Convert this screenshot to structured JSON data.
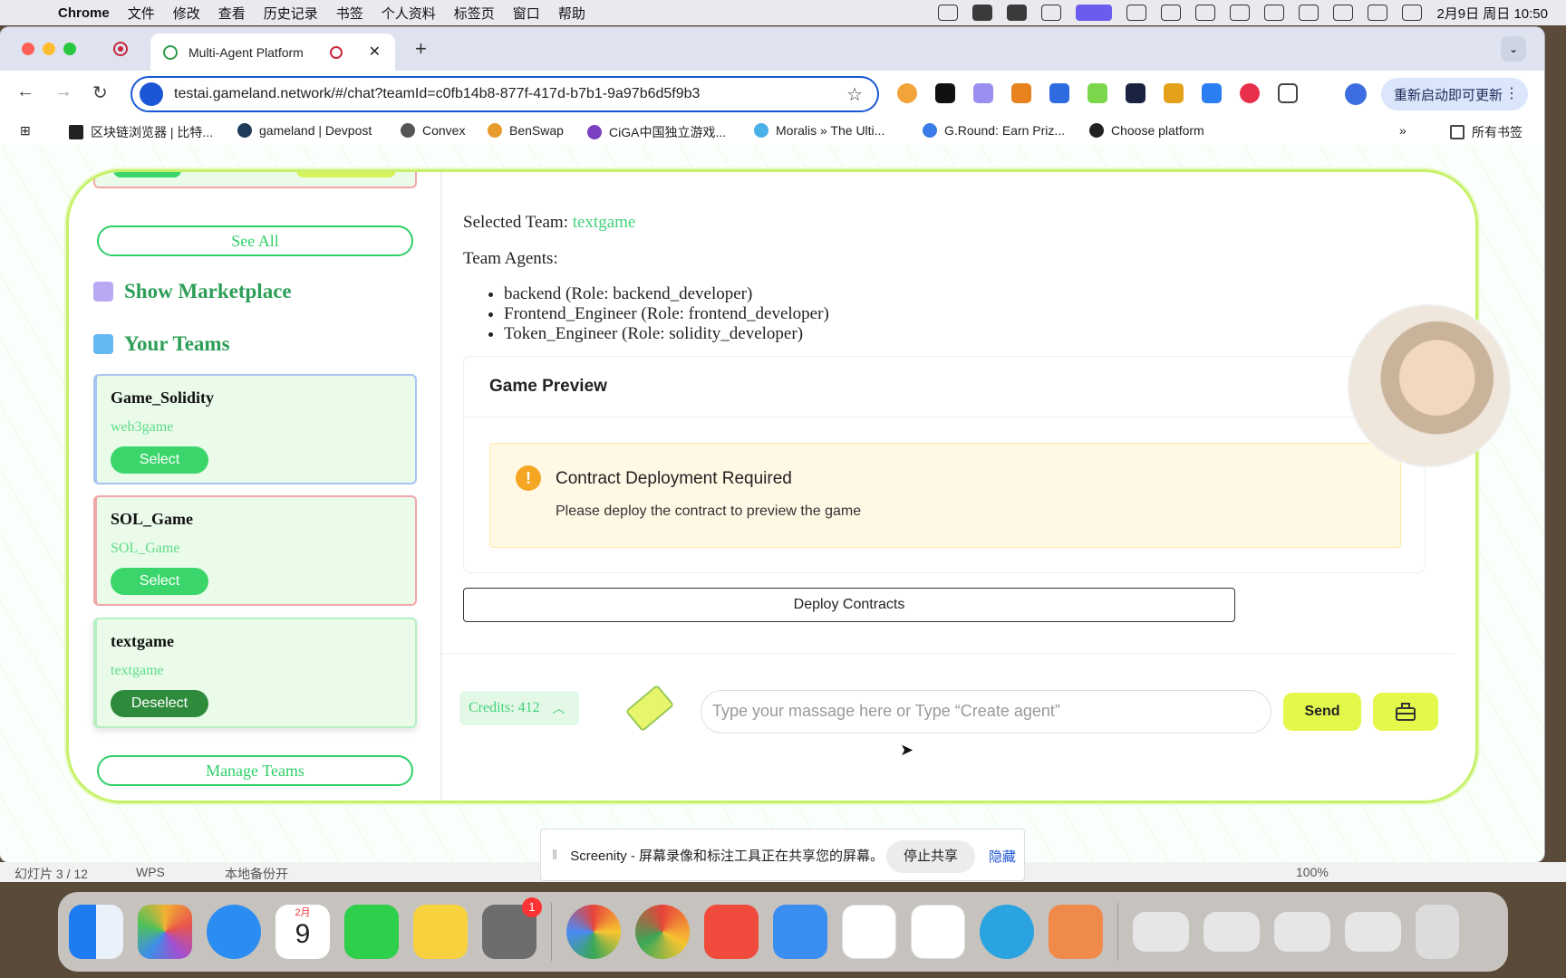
{
  "menubar": {
    "app": "Chrome",
    "items": [
      "文件",
      "修改",
      "查看",
      "历史记录",
      "书签",
      "个人资料",
      "标签页",
      "窗口",
      "帮助"
    ],
    "clock": "2月9日 周日 10:50"
  },
  "browser": {
    "tab_title": "Multi-Agent Platform",
    "url": "testai.gameland.network/#/chat?teamId=c0fb14b8-877f-417d-b7b1-9a97b6d5f9b3",
    "update_button": "重新启动即可更新",
    "bookmarks": [
      "区块链浏览器 | 比特...",
      "gameland | Devpost",
      "Convex",
      "BenSwap",
      "CiGA中国独立游戏...",
      "Moralis » The Ulti...",
      "G.Round: Earn Priz...",
      "Choose platform"
    ],
    "all_bookmarks": "所有书签"
  },
  "sidebar": {
    "see_all": "See All",
    "show_marketplace": "Show Marketplace",
    "your_teams": "Your Teams",
    "teams": [
      {
        "name": "Game_Solidity",
        "desc": "web3game",
        "button": "Select"
      },
      {
        "name": "SOL_Game",
        "desc": "SOL_Game",
        "button": "Select"
      },
      {
        "name": "textgame",
        "desc": "textgame",
        "button": "Deselect"
      }
    ],
    "manage_teams": "Manage Teams"
  },
  "main": {
    "selected_team_label": "Selected Team:",
    "selected_team_value": "textgame",
    "team_agents_label": "Team Agents:",
    "agents": [
      "backend (Role: backend_developer)",
      "Frontend_Engineer (Role: frontend_developer)",
      "Token_Engineer (Role: solidity_developer)"
    ],
    "preview_title": "Game Preview",
    "alert_title": "Contract Deployment Required",
    "alert_message": "Please deploy the contract to preview the game",
    "deploy_button": "Deploy Contracts",
    "credits": "Credits: 412",
    "input_placeholder": "Type your massage here or Type “Create agent”",
    "send_button": "Send"
  },
  "share_bar": {
    "message": "Screenity - 屏幕录像和标注工具正在共享您的屏幕。",
    "stop": "停止共享",
    "hide": "隐藏"
  },
  "wps_strip": {
    "slide": "幻灯片 3 / 12",
    "app": "WPS",
    "backup": "本地备份开",
    "zoom": "100%"
  },
  "dock": {
    "calendar_month": "2月",
    "calendar_day": "9",
    "settings_badge": "1"
  },
  "colors": {
    "accent_green": "#3bd66b",
    "lime": "#e3f84b",
    "alert_bg": "#fff8e5"
  }
}
